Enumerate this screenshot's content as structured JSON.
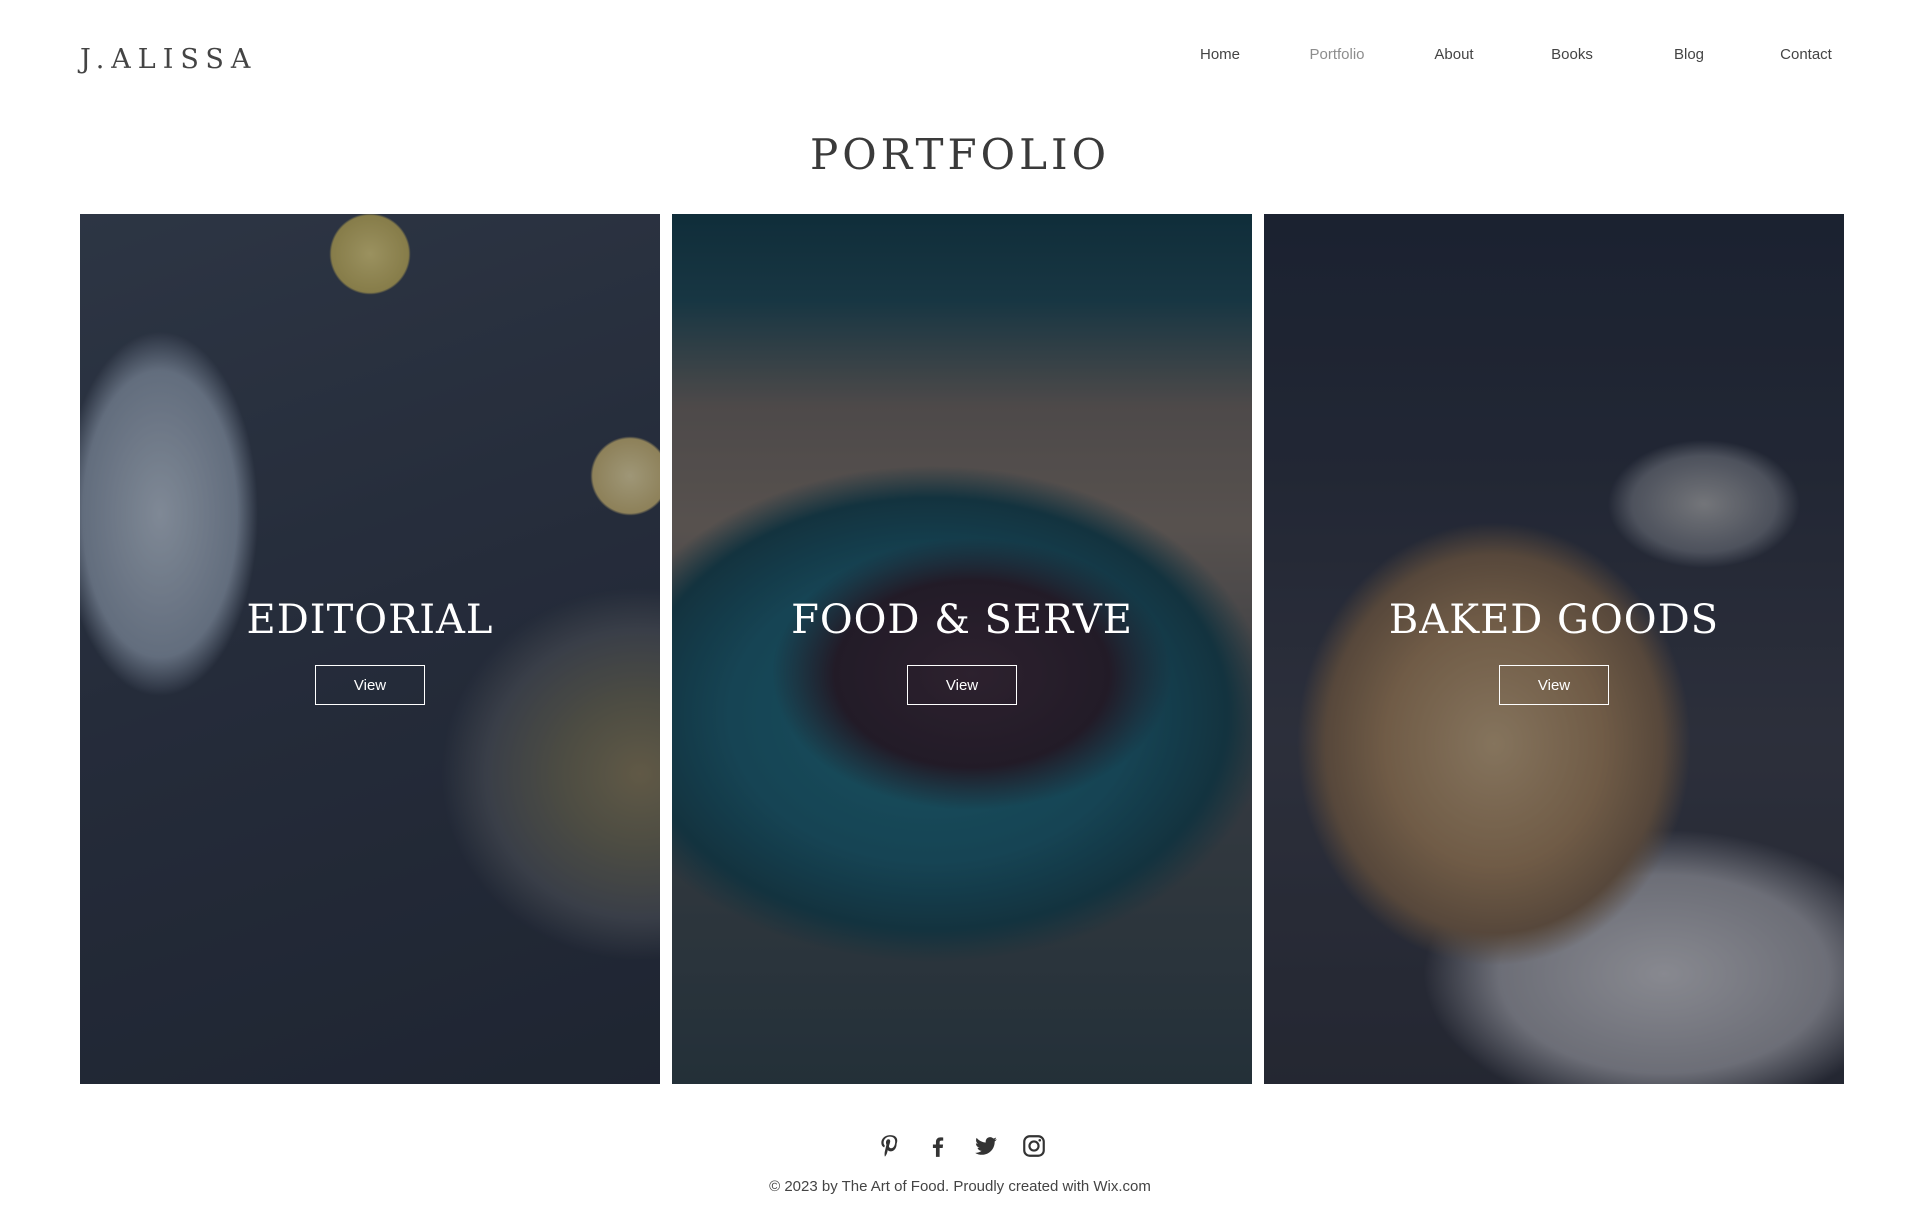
{
  "site": {
    "logo": "J.ALISSA"
  },
  "nav": {
    "items": [
      {
        "label": "Home",
        "active": false
      },
      {
        "label": "Portfolio",
        "active": true
      },
      {
        "label": "About",
        "active": false
      },
      {
        "label": "Books",
        "active": false
      },
      {
        "label": "Blog",
        "active": false
      },
      {
        "label": "Contact",
        "active": false
      }
    ]
  },
  "page": {
    "title": "PORTFOLIO"
  },
  "cards": [
    {
      "title": "EDITORIAL",
      "button": "View"
    },
    {
      "title": "FOOD & SERVE",
      "button": "View"
    },
    {
      "title": "BAKED GOODS",
      "button": "View"
    }
  ],
  "social": {
    "icons": [
      "pinterest-icon",
      "facebook-icon",
      "twitter-icon",
      "instagram-icon"
    ]
  },
  "footer": {
    "text": "© 2023 by The Art of Food. Proudly created with ",
    "link": "Wix.com"
  },
  "colors": {
    "text": "#444444",
    "active_nav": "#8d8d8d",
    "overlay": "#141c2c"
  }
}
